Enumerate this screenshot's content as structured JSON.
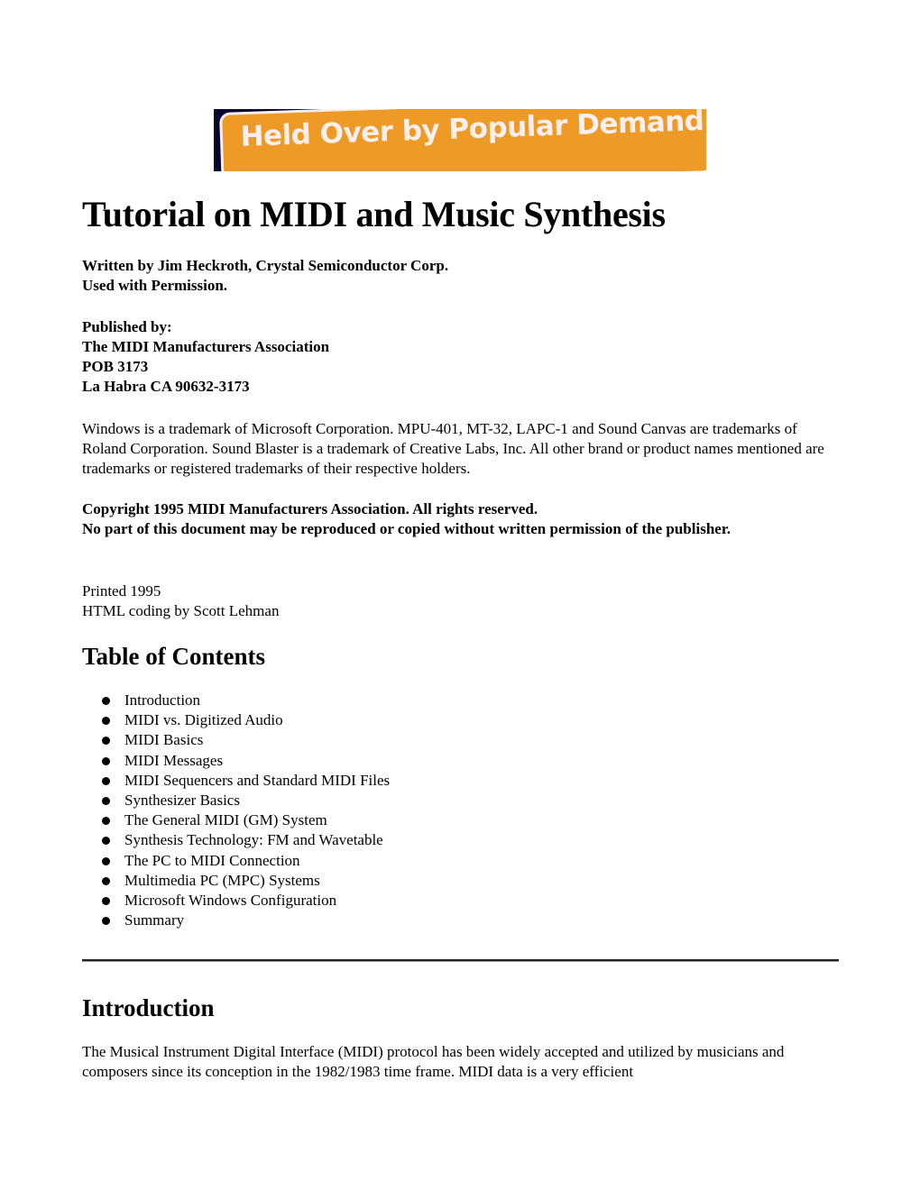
{
  "banner": {
    "text": "Held Over by Popular Demand!",
    "colors": {
      "background": "#05052e",
      "plate": "#ee9a26",
      "text": "#fdeeee"
    }
  },
  "title": "Tutorial on MIDI and Music Synthesis",
  "byline": {
    "line1": "Written by Jim Heckroth, Crystal Semiconductor Corp.",
    "line2": "Used with Permission."
  },
  "publisher": {
    "label": "Published by:",
    "name": "The MIDI Manufacturers Association",
    "address1": "POB 3173",
    "address2": "La Habra CA 90632-3173"
  },
  "trademarks": "Windows is a trademark of Microsoft Corporation. MPU-401, MT-32, LAPC-1 and Sound Canvas are trademarks of Roland Corporation. Sound Blaster is a trademark of Creative Labs, Inc. All other brand or product names mentioned are trademarks or registered trademarks of their respective holders.",
  "copyright": {
    "line1": "Copyright 1995 MIDI Manufacturers Association. All rights reserved.",
    "line2": "No part of this document may be reproduced or copied without written permission of the publisher."
  },
  "credits": {
    "printed": "Printed 1995",
    "html_coding": "HTML coding by Scott Lehman"
  },
  "toc": {
    "heading": "Table of Contents",
    "items": [
      "Introduction",
      "MIDI vs. Digitized Audio",
      "MIDI Basics",
      "MIDI Messages",
      "MIDI Sequencers and Standard MIDI Files",
      "Synthesizer Basics",
      "The General MIDI (GM) System",
      "Synthesis Technology: FM and Wavetable",
      "The PC to MIDI Connection",
      "Multimedia PC (MPC) Systems",
      "Microsoft Windows Configuration",
      "Summary"
    ]
  },
  "introduction": {
    "heading": "Introduction",
    "text": "The Musical Instrument Digital Interface (MIDI) protocol has been widely accepted and utilized by musicians and composers since its conception in the 1982/1983 time frame. MIDI data is a very efficient"
  }
}
